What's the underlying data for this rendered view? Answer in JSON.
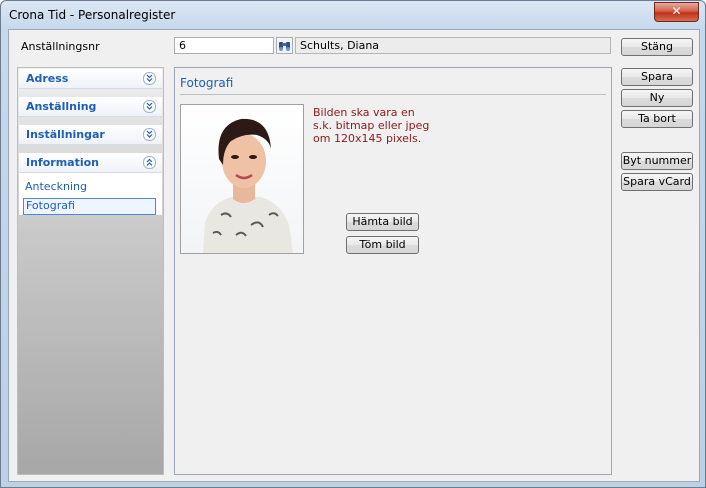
{
  "window": {
    "title": "Crona Tid - Personalregister",
    "close_glyph": "✕"
  },
  "topbar": {
    "emp_label": "Anställningsnr",
    "emp_value": "6",
    "name": "Schults, Diana",
    "close_label": "Stäng"
  },
  "actions": {
    "save": "Spara",
    "new": "Ny",
    "delete": "Ta bort",
    "change_number": "Byt nummer",
    "save_vcard": "Spara vCard"
  },
  "sidebar": {
    "sections": [
      "Adress",
      "Anställning",
      "Inställningar",
      "Information"
    ],
    "information_items": [
      "Anteckning",
      "Fotografi"
    ]
  },
  "panel": {
    "title": "Fotografi",
    "hint_lines": [
      "Bilden ska vara en",
      "s.k. bitmap eller jpeg",
      "om 120x145 pixels."
    ],
    "fetch_label": "Hämta bild",
    "clear_label": "Töm bild"
  },
  "colors": {
    "accent": "#1e5fb3",
    "hint": "#8b1a1a"
  }
}
